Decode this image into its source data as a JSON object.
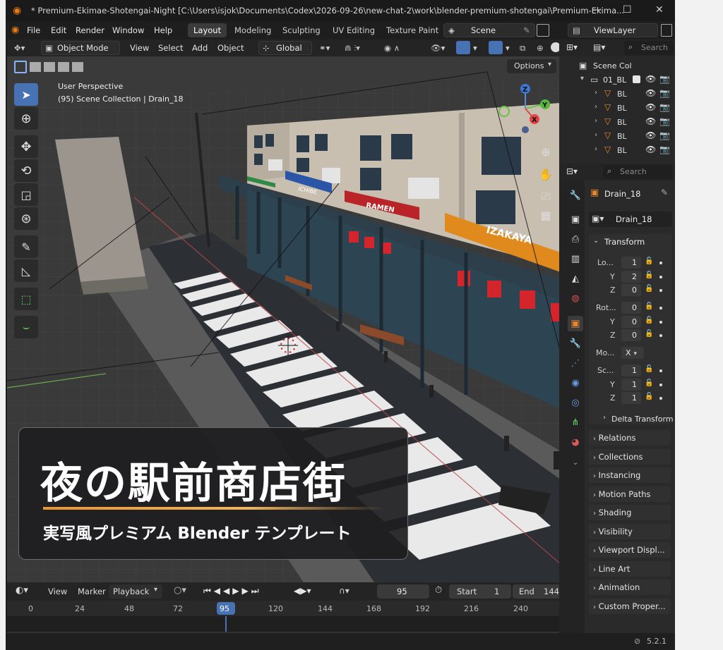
{
  "window": {
    "title": "* Premium-Ekimae-Shotengai-Night [C:\\Users\\isjok\\Documents\\Codex\\2026-09-26\\new-chat-2\\work\\blender-premium-shotengai\\Premium-Ekima..."
  },
  "menu": {
    "items": [
      "File",
      "Edit",
      "Render",
      "Window",
      "Help"
    ]
  },
  "workspaces": [
    "Layout",
    "Modeling",
    "Sculpting",
    "UV Editing",
    "Texture Paint"
  ],
  "scene_name": "Scene",
  "view_layer": "ViewLayer",
  "viewport_header": {
    "mode": "Object Mode",
    "view": "View",
    "select": "Select",
    "add": "Add",
    "object": "Object",
    "orientation": "Global",
    "options": "Options"
  },
  "overlay_text": {
    "perspective": "User Perspective",
    "collection_info": "(95) Scene Collection | Drain_18"
  },
  "gizmo": {
    "z": "Z",
    "y": "Y",
    "x": "X"
  },
  "scene_signs": {
    "ramen": "RAMEN",
    "izakaya": "IZAKAYA",
    "shop2": "ICHIBE"
  },
  "banner": {
    "title": "夜の駅前商店街",
    "subtitle": "実写風プレミアム Blender テンプレート"
  },
  "timeline": {
    "view": "View",
    "marker": "Marker",
    "playback": "Playback",
    "current_frame": "95",
    "start_label": "Start",
    "start": "1",
    "end_label": "End",
    "end": "144",
    "ruler": [
      "0",
      "24",
      "48",
      "72",
      "95",
      "120",
      "144",
      "168",
      "192",
      "216",
      "240"
    ]
  },
  "outliner": {
    "search_placeholder": "Search",
    "root": "Scene Col",
    "collection": "01_BL",
    "items": [
      "BL",
      "BL",
      "BL",
      "BL",
      "BL"
    ]
  },
  "properties": {
    "search_placeholder": "Search",
    "object_name": "Drain_18",
    "data_name": "Drain_18",
    "transform_label": "Transform",
    "location_label": "Lo...",
    "location": {
      "x": "1",
      "y": "2",
      "z": "0"
    },
    "rotation_label": "Rot...",
    "rotation": {
      "x": "0",
      "y": "0",
      "z": "0"
    },
    "mode_label": "Mo...",
    "mode_value": "X",
    "scale_label": "Sc...",
    "scale": {
      "x": "1",
      "y": "1",
      "z": "1"
    },
    "axis": {
      "y": "Y",
      "z": "Z"
    },
    "delta_transform": "Delta Transform",
    "panels": [
      "Relations",
      "Collections",
      "Instancing",
      "Motion Paths",
      "Shading",
      "Visibility",
      "Viewport Displ...",
      "Line Art",
      "Animation",
      "Custom Proper..."
    ]
  },
  "status": {
    "version": "5.2.1"
  },
  "colors": {
    "accent": "#4772b3",
    "banner_line": "#e8952c",
    "sign_ramen": "#c0282c",
    "sign_izakaya": "#e08a1e"
  }
}
